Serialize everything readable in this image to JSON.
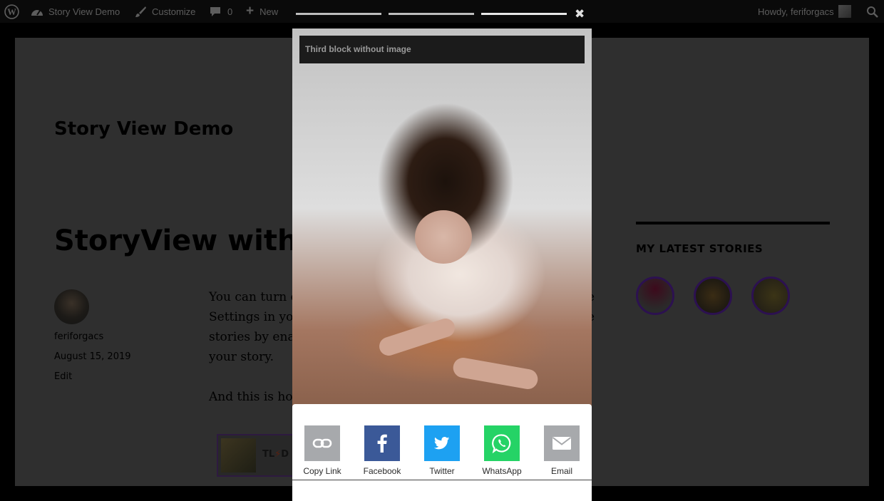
{
  "admin_bar": {
    "site_name": "Story View Demo",
    "customize": "Customize",
    "comments_count": "0",
    "new_label": "New",
    "greeting": "Howdy, feriforgacs"
  },
  "page": {
    "site_title": "Story View Demo",
    "post_title": "StoryView with s",
    "author": "feriforgacs",
    "date": "August 15, 2019",
    "edit": "Edit",
    "content_lines": [
      "You can turn o",
      "Settings in you",
      "stories by enab",
      "your story."
    ],
    "content_right_chars": [
      "e",
      "e"
    ],
    "content_second_para": "And this is how",
    "embed_text": "TL",
    "embed_bolt": "⚡",
    "embed_text_after": "D",
    "widget_title": "MY LATEST STORIES"
  },
  "story": {
    "header_text": "Third block without image",
    "progress_segments": 3,
    "close_symbol": "✖"
  },
  "share": {
    "items": [
      {
        "label": "Copy Link",
        "icon": "link-icon",
        "color": "#a7a9ac"
      },
      {
        "label": "Facebook",
        "icon": "facebook-icon",
        "color": "#3b5998"
      },
      {
        "label": "Twitter",
        "icon": "twitter-icon",
        "color": "#1da1f2"
      },
      {
        "label": "WhatsApp",
        "icon": "whatsapp-icon",
        "color": "#25d366"
      },
      {
        "label": "Email",
        "icon": "email-icon",
        "color": "#a7a9ac"
      }
    ]
  }
}
